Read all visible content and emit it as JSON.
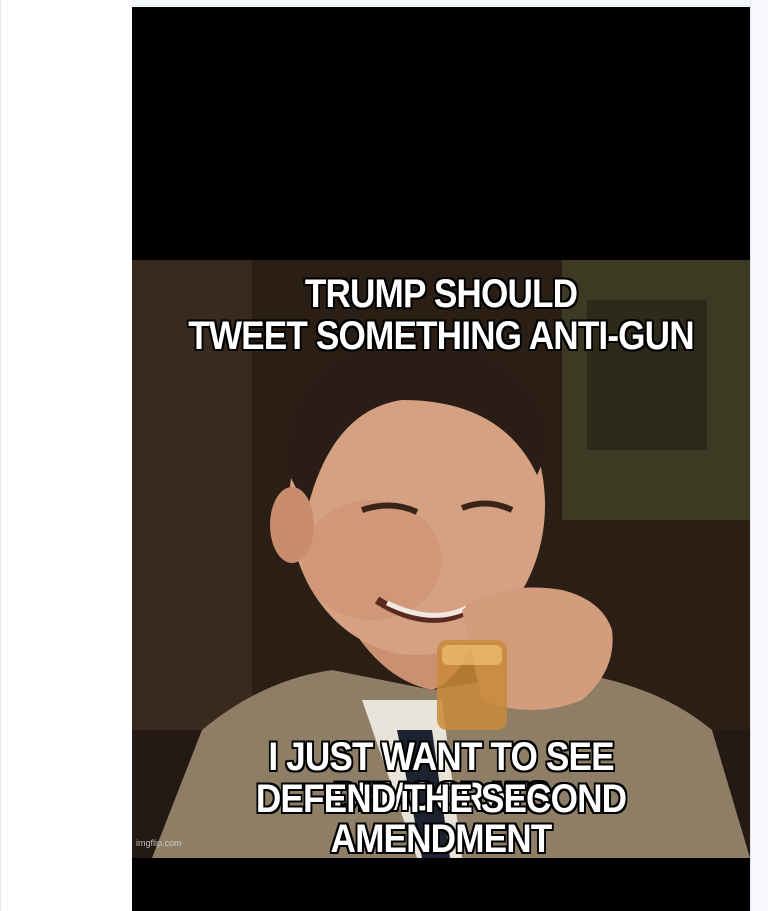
{
  "post": {
    "image_alt": "Meme image",
    "caption_top": [
      "TRUMP SHOULD",
      "TWEET SOMETHING ANTI-GUN"
    ],
    "caption_bottom": [
      "I JUST WANT TO SEE DEMOCRATS",
      "DEFEND THE SECOND AMENDMENT"
    ],
    "watermark": "imgflip.com"
  },
  "colors": {
    "page_background": "#ffffff",
    "image_letterbox": "#000000",
    "caption_text": "#ffffff",
    "caption_outline": "#000000"
  }
}
